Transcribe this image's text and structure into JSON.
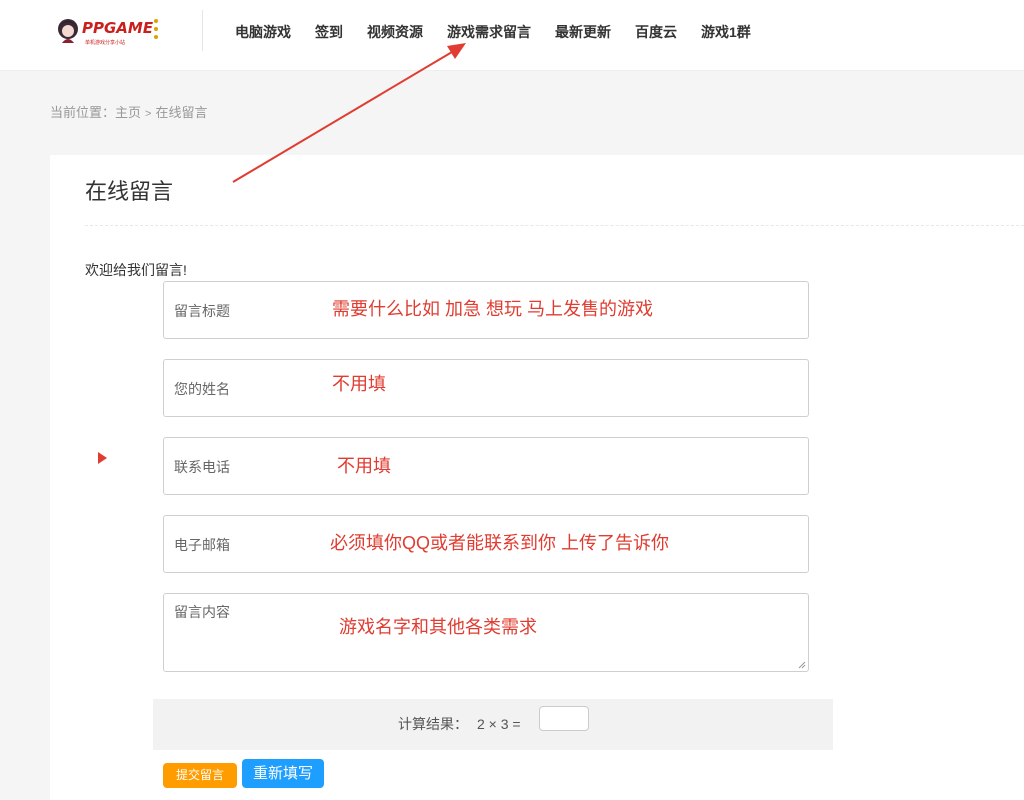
{
  "header": {
    "logo_text": "PPGAME",
    "logo_subtext": "单机游戏分享小站",
    "nav": [
      {
        "label": "电脑游戏"
      },
      {
        "label": "签到"
      },
      {
        "label": "视频资源"
      },
      {
        "label": "游戏需求留言"
      },
      {
        "label": "最新更新"
      },
      {
        "label": "百度云"
      },
      {
        "label": "游戏1群"
      }
    ]
  },
  "breadcrumb": {
    "prefix": "当前位置：",
    "home": "主页",
    "separator": ">",
    "current": "在线留言"
  },
  "main": {
    "title": "在线留言",
    "welcome": "欢迎给我们留言!",
    "fields": [
      {
        "label": "留言标题",
        "annotation": "需要什么比如 加急 想玩 马上发售的游戏"
      },
      {
        "label": "您的姓名",
        "annotation": "不用填"
      },
      {
        "label": "联系电话",
        "annotation": "不用填"
      },
      {
        "label": "电子邮箱",
        "annotation": "必须填你QQ或者能联系到你 上传了告诉你"
      },
      {
        "label": "留言内容",
        "annotation": "游戏名字和其他各类需求"
      }
    ],
    "captcha": {
      "label": "计算结果：",
      "expression": "2 × 3 =",
      "value": ""
    },
    "buttons": {
      "submit": "提交留言",
      "reset": "重新填写"
    }
  },
  "colors": {
    "annotation": "#e03c31",
    "submit_bg": "#ff9d00",
    "reset_bg": "#1e9fff"
  },
  "icons": {
    "arrow": "annotation-arrow",
    "marker": "triangle-marker-icon"
  }
}
